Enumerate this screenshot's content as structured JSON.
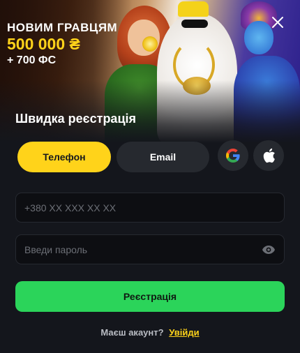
{
  "banner": {
    "promo_line1": "НОВИМ ГРАВЦЯМ",
    "promo_amount": "500 000 ₴",
    "promo_fs": "+ 700 ФС",
    "title": "Швидка реєстрація"
  },
  "tabs": [
    {
      "label": "Телефон",
      "active": true
    },
    {
      "label": "Email",
      "active": false
    }
  ],
  "social": [
    "google-icon",
    "apple-icon"
  ],
  "form": {
    "phone_placeholder": "+380 XX XXX XX XX",
    "phone_value": "",
    "password_placeholder": "Введи пароль",
    "password_value": "",
    "submit_label": "Реєстрація"
  },
  "footer": {
    "question": "Маєш акаунт?",
    "login_link": "Увійди"
  },
  "colors": {
    "accent_yellow": "#ffd31a",
    "submit_green": "#2bd45a",
    "background": "#14161c"
  }
}
